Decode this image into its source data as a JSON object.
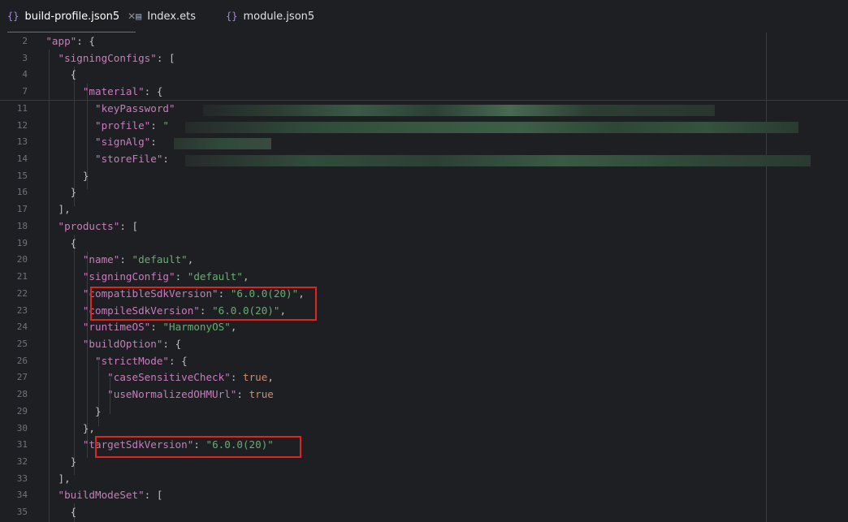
{
  "tabs": [
    {
      "label": "build-profile.json5",
      "icon": "json-braces-icon",
      "active": true,
      "closable": true
    },
    {
      "label": "Index.ets",
      "icon": "ets-file-icon",
      "active": false,
      "closable": false
    },
    {
      "label": "module.json5",
      "icon": "json-braces-icon",
      "active": false,
      "closable": false
    }
  ],
  "code": {
    "lines": [
      {
        "num": "2",
        "tokens": [
          [
            "p",
            "    "
          ],
          [
            "k",
            "\"app\""
          ],
          [
            "p",
            ": {"
          ]
        ]
      },
      {
        "num": "3",
        "tokens": [
          [
            "p",
            "      "
          ],
          [
            "k",
            "\"signingConfigs\""
          ],
          [
            "p",
            ": ["
          ]
        ]
      },
      {
        "num": "4",
        "tokens": [
          [
            "p",
            "        {"
          ]
        ]
      },
      {
        "num": "7",
        "tokens": [
          [
            "p",
            "          "
          ],
          [
            "k",
            "\"material\""
          ],
          [
            "p",
            ": {"
          ]
        ]
      },
      {
        "num": "11",
        "tokens": [
          [
            "p",
            "            "
          ],
          [
            "k",
            "\"keyPassword\""
          ]
        ]
      },
      {
        "num": "12",
        "tokens": [
          [
            "p",
            "            "
          ],
          [
            "k",
            "\"profile\""
          ],
          [
            "p",
            ": "
          ],
          [
            "s",
            "\""
          ]
        ]
      },
      {
        "num": "13",
        "tokens": [
          [
            "p",
            "            "
          ],
          [
            "k",
            "\"signAlg\""
          ],
          [
            "p",
            ": "
          ]
        ]
      },
      {
        "num": "14",
        "tokens": [
          [
            "p",
            "            "
          ],
          [
            "k",
            "\"storeFile\""
          ],
          [
            "p",
            ": "
          ]
        ]
      },
      {
        "num": "15",
        "tokens": [
          [
            "p",
            "          }"
          ]
        ]
      },
      {
        "num": "16",
        "tokens": [
          [
            "p",
            "        }"
          ]
        ]
      },
      {
        "num": "17",
        "tokens": [
          [
            "p",
            "      ],"
          ]
        ]
      },
      {
        "num": "18",
        "tokens": [
          [
            "p",
            "      "
          ],
          [
            "k",
            "\"products\""
          ],
          [
            "p",
            ": ["
          ]
        ]
      },
      {
        "num": "19",
        "tokens": [
          [
            "p",
            "        {"
          ]
        ]
      },
      {
        "num": "20",
        "tokens": [
          [
            "p",
            "          "
          ],
          [
            "k",
            "\"name\""
          ],
          [
            "p",
            ": "
          ],
          [
            "s",
            "\"default\""
          ],
          [
            "p",
            ","
          ]
        ]
      },
      {
        "num": "21",
        "tokens": [
          [
            "p",
            "          "
          ],
          [
            "k",
            "\"signingConfig\""
          ],
          [
            "p",
            ": "
          ],
          [
            "s",
            "\"default\""
          ],
          [
            "p",
            ","
          ]
        ]
      },
      {
        "num": "22",
        "tokens": [
          [
            "p",
            "          "
          ],
          [
            "k",
            "\"compatibleSdkVersion\""
          ],
          [
            "p",
            ": "
          ],
          [
            "s",
            "\"6.0.0(20)\""
          ],
          [
            "p",
            ","
          ]
        ]
      },
      {
        "num": "23",
        "tokens": [
          [
            "p",
            "          "
          ],
          [
            "k",
            "\"compileSdkVersion\""
          ],
          [
            "p",
            ": "
          ],
          [
            "s",
            "\"6.0.0(20)\""
          ],
          [
            "p",
            ","
          ]
        ]
      },
      {
        "num": "24",
        "tokens": [
          [
            "p",
            "          "
          ],
          [
            "k",
            "\"runtimeOS\""
          ],
          [
            "p",
            ": "
          ],
          [
            "s",
            "\"HarmonyOS\""
          ],
          [
            "p",
            ","
          ]
        ]
      },
      {
        "num": "25",
        "tokens": [
          [
            "p",
            "          "
          ],
          [
            "k",
            "\"buildOption\""
          ],
          [
            "p",
            ": {"
          ]
        ]
      },
      {
        "num": "26",
        "tokens": [
          [
            "p",
            "            "
          ],
          [
            "k",
            "\"strictMode\""
          ],
          [
            "p",
            ": {"
          ]
        ]
      },
      {
        "num": "27",
        "tokens": [
          [
            "p",
            "              "
          ],
          [
            "k",
            "\"caseSensitiveCheck\""
          ],
          [
            "p",
            ": "
          ],
          [
            "b",
            "true"
          ],
          [
            "p",
            ","
          ]
        ]
      },
      {
        "num": "28",
        "tokens": [
          [
            "p",
            "              "
          ],
          [
            "k",
            "\"useNormalizedOHMUrl\""
          ],
          [
            "p",
            ": "
          ],
          [
            "b",
            "true"
          ]
        ]
      },
      {
        "num": "29",
        "tokens": [
          [
            "p",
            "            }"
          ]
        ]
      },
      {
        "num": "30",
        "tokens": [
          [
            "p",
            "          },"
          ]
        ]
      },
      {
        "num": "31",
        "tokens": [
          [
            "p",
            "          "
          ],
          [
            "k",
            "\"targetSdkVersion\""
          ],
          [
            "p",
            ": "
          ],
          [
            "s",
            "\"6.0.0(20)\""
          ]
        ]
      },
      {
        "num": "32",
        "tokens": [
          [
            "p",
            "        }"
          ]
        ]
      },
      {
        "num": "33",
        "tokens": [
          [
            "p",
            "      ],"
          ]
        ]
      },
      {
        "num": "34",
        "tokens": [
          [
            "p",
            "      "
          ],
          [
            "k",
            "\"buildModeSet\""
          ],
          [
            "p",
            ": ["
          ]
        ]
      },
      {
        "num": "35",
        "tokens": [
          [
            "p",
            "        {"
          ]
        ]
      }
    ]
  },
  "colors": {
    "key": "#c77dbb",
    "string": "#6aab73",
    "boolean": "#cf8e6d",
    "highlight_box": "#e0241f",
    "redaction": "#2f4a3a"
  }
}
